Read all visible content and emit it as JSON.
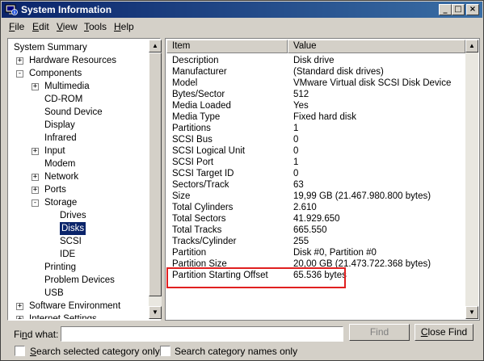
{
  "window": {
    "title": "System Information",
    "controls": {
      "minimize": "_",
      "maximize": "□",
      "close": "×"
    }
  },
  "menu": [
    {
      "label": "File",
      "mnemonic": "F"
    },
    {
      "label": "Edit",
      "mnemonic": "E"
    },
    {
      "label": "View",
      "mnemonic": "V"
    },
    {
      "label": "Tools",
      "mnemonic": "T"
    },
    {
      "label": "Help",
      "mnemonic": "H"
    }
  ],
  "tree": {
    "items": [
      {
        "label": "System Summary",
        "level": 0,
        "expander": ""
      },
      {
        "label": "Hardware Resources",
        "level": 1,
        "expander": "+"
      },
      {
        "label": "Components",
        "level": 1,
        "expander": "−"
      },
      {
        "label": "Multimedia",
        "level": 2,
        "expander": "+"
      },
      {
        "label": "CD-ROM",
        "level": 2,
        "expander": ""
      },
      {
        "label": "Sound Device",
        "level": 2,
        "expander": ""
      },
      {
        "label": "Display",
        "level": 2,
        "expander": ""
      },
      {
        "label": "Infrared",
        "level": 2,
        "expander": ""
      },
      {
        "label": "Input",
        "level": 2,
        "expander": "+"
      },
      {
        "label": "Modem",
        "level": 2,
        "expander": ""
      },
      {
        "label": "Network",
        "level": 2,
        "expander": "+"
      },
      {
        "label": "Ports",
        "level": 2,
        "expander": "+"
      },
      {
        "label": "Storage",
        "level": 2,
        "expander": "−"
      },
      {
        "label": "Drives",
        "level": 3,
        "expander": ""
      },
      {
        "label": "Disks",
        "level": 3,
        "expander": "",
        "selected": true
      },
      {
        "label": "SCSI",
        "level": 3,
        "expander": ""
      },
      {
        "label": "IDE",
        "level": 3,
        "expander": ""
      },
      {
        "label": "Printing",
        "level": 2,
        "expander": ""
      },
      {
        "label": "Problem Devices",
        "level": 2,
        "expander": ""
      },
      {
        "label": "USB",
        "level": 2,
        "expander": ""
      },
      {
        "label": "Software Environment",
        "level": 1,
        "expander": "+"
      },
      {
        "label": "Internet Settings",
        "level": 1,
        "expander": "+"
      }
    ]
  },
  "list": {
    "headers": [
      "Item",
      "Value"
    ],
    "rows": [
      [
        "Description",
        "Disk drive"
      ],
      [
        "Manufacturer",
        "(Standard disk drives)"
      ],
      [
        "Model",
        "VMware Virtual disk SCSI Disk Device"
      ],
      [
        "Bytes/Sector",
        "512"
      ],
      [
        "Media Loaded",
        "Yes"
      ],
      [
        "Media Type",
        "Fixed hard disk"
      ],
      [
        "Partitions",
        "1"
      ],
      [
        "SCSI Bus",
        "0"
      ],
      [
        "SCSI Logical Unit",
        "0"
      ],
      [
        "SCSI Port",
        "1"
      ],
      [
        "SCSI Target ID",
        "0"
      ],
      [
        "Sectors/Track",
        "63"
      ],
      [
        "Size",
        "19,99 GB (21.467.980.800 bytes)"
      ],
      [
        "Total Cylinders",
        "2.610"
      ],
      [
        "Total Sectors",
        "41.929.650"
      ],
      [
        "Total Tracks",
        "665.550"
      ],
      [
        "Tracks/Cylinder",
        "255"
      ],
      [
        "Partition",
        "Disk #0, Partition #0"
      ],
      [
        "Partition Size",
        "20,00 GB (21.473.722.368 bytes)"
      ],
      [
        "Partition Starting Offset",
        "65.536 bytes"
      ]
    ],
    "highlight_color": "#e02020"
  },
  "find": {
    "label": "Find what:",
    "value": "",
    "find_button": "Find",
    "close_button": "Close Find",
    "check1": "Search selected category only",
    "check2": "Search category names only"
  },
  "colors": {
    "title_gradient_start": "#0a246a",
    "title_gradient_end": "#3a6ea5",
    "selection": "#0a246a"
  }
}
